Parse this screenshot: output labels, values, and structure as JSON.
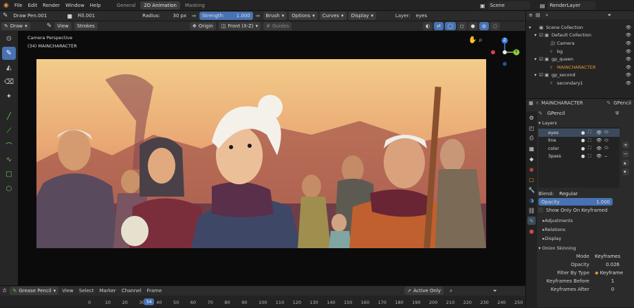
{
  "topbar": {
    "menus": [
      "File",
      "Edit",
      "Render",
      "Window",
      "Help"
    ],
    "workspaces": [
      "General",
      "2D Animation",
      "Masking"
    ],
    "scene": "Scene",
    "render_layer": "RenderLayer"
  },
  "header2": {
    "brush": "Draw Pen.001",
    "material": "Fill.001",
    "radius_label": "Radius:",
    "radius_value": "30 px",
    "strength_label": "Strength:",
    "strength_value": "1.000",
    "menus": [
      "Brush",
      "Options",
      "Curves",
      "Display"
    ],
    "layer_label": "Layer:",
    "layer_value": "eyes"
  },
  "header3": {
    "mode": "Draw",
    "view": "View",
    "strokes": "Strokes",
    "origin": "Origin",
    "projection": "Front (X-Z)",
    "guides": "Guides"
  },
  "viewport": {
    "title": "Camera Perspective",
    "subtitle": "(34) MAINCHARACTER",
    "gizmo_z": "Z",
    "gizmo_y": "Y"
  },
  "outliner": {
    "search_placeholder": "",
    "rows": [
      {
        "label": "Scene Collection",
        "indent": 0,
        "icon": "collection"
      },
      {
        "label": "Default Collection",
        "indent": 1,
        "icon": "collection"
      },
      {
        "label": "Camera",
        "indent": 2,
        "icon": "camera"
      },
      {
        "label": "bg",
        "indent": 2,
        "icon": "gpencil"
      },
      {
        "label": "gp_queen",
        "indent": 1,
        "icon": "collection"
      },
      {
        "label": "MAINCHARACTER",
        "indent": 2,
        "icon": "gpencil",
        "highlight": true
      },
      {
        "label": "gp_second",
        "indent": 1,
        "icon": "collection"
      },
      {
        "label": "secondary1",
        "indent": 2,
        "icon": "gpencil"
      }
    ]
  },
  "props": {
    "object": "MAINCHARACTER",
    "data_tab": "GPencil",
    "datablock": "GPencil",
    "layers_title": "Layers",
    "layers": [
      "eyes",
      "line",
      "color",
      "3pass"
    ],
    "blend_label": "Blend:",
    "blend_value": "Regular",
    "opacity_label": "Opacity",
    "opacity_value": "1.000",
    "show_only_keyframed": "Show Only On Keyframed",
    "subpanels": [
      "Adjustments",
      "Relations",
      "Display"
    ],
    "onion_title": "Onion Skinning",
    "mode_label": "Mode",
    "mode_value": "Keyframes",
    "onion_opacity_label": "Opacity",
    "onion_opacity_value": "0.026",
    "filter_label": "Filter By Type",
    "filter_value": "Keyframe",
    "kf_before_label": "Keyframes Before",
    "kf_before_value": "1",
    "kf_after_label": "Keyframes After",
    "kf_after_value": "0"
  },
  "timeline": {
    "editor": "Grease Pencil",
    "menus": [
      "View",
      "Select",
      "Marker",
      "Channel",
      "Frame"
    ],
    "active_only": "Active Only",
    "current_frame": "34",
    "ticks": [
      "0",
      "10",
      "20",
      "30",
      "40",
      "50",
      "60",
      "70",
      "80",
      "90",
      "100",
      "110",
      "120",
      "130",
      "140",
      "150",
      "160",
      "170",
      "180",
      "190",
      "200",
      "210",
      "220",
      "230",
      "240",
      "250"
    ]
  },
  "colors": {
    "accent": "#4772b3",
    "highlight": "#e49a35"
  }
}
